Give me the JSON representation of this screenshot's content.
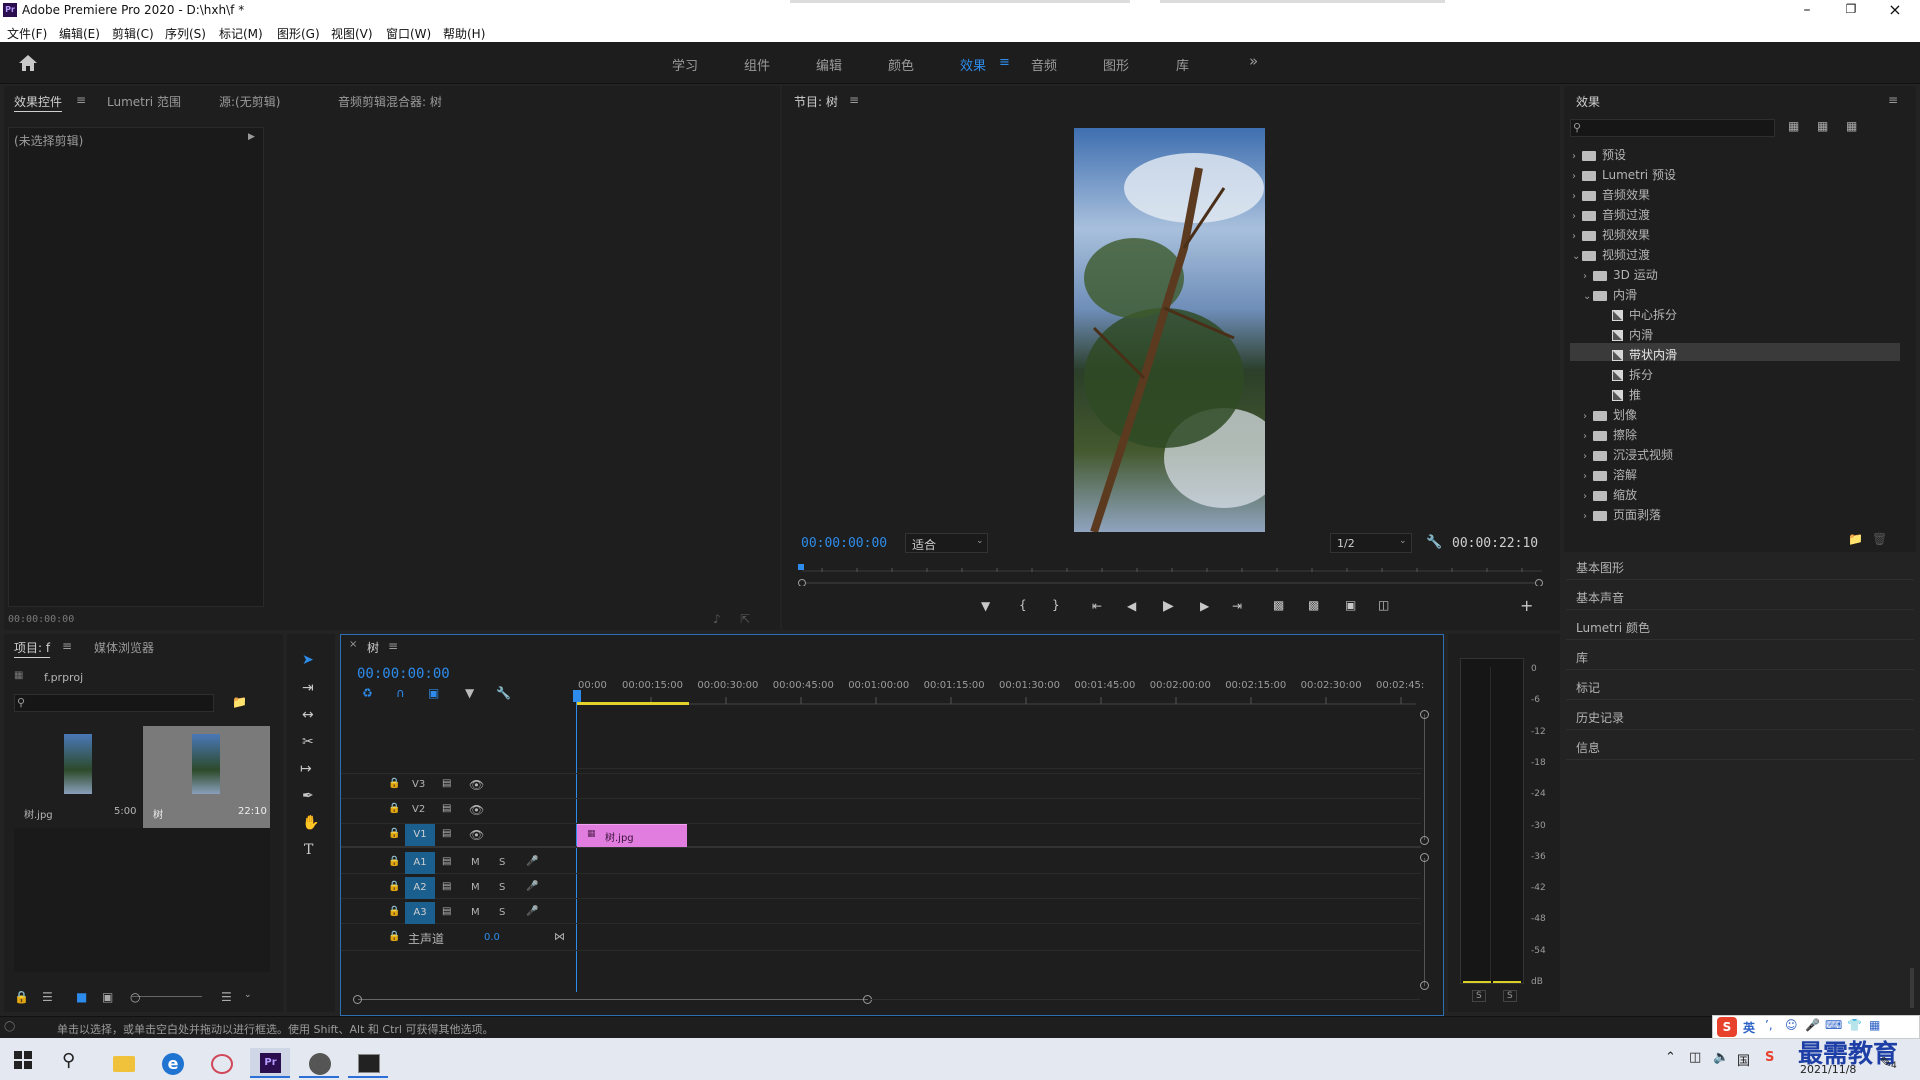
{
  "app": {
    "title": "Adobe Premiere Pro 2020 - D:\\hxh\\f *",
    "icon_text": "Pr"
  },
  "menu": [
    "文件(F)",
    "编辑(E)",
    "剪辑(C)",
    "序列(S)",
    "标记(M)",
    "图形(G)",
    "视图(V)",
    "窗口(W)",
    "帮助(H)"
  ],
  "workspaces": [
    "学习",
    "组件",
    "编辑",
    "颜色",
    "效果",
    "音频",
    "图形",
    "库"
  ],
  "workspace_active": "效果",
  "left_panel": {
    "tabs": [
      "效果控件",
      "Lumetri 范围",
      "源:(无剪辑)",
      "音频剪辑混合器: 树"
    ],
    "no_clip": "(未选择剪辑)",
    "timecode": "00:00:00:00"
  },
  "program": {
    "title": "节目: 树",
    "timecode": "00:00:00:00",
    "fit": "适合",
    "quality": "1/2",
    "duration": "00:00:22:10"
  },
  "effects_panel": {
    "title": "效果",
    "search_placeholder": "",
    "tree": [
      {
        "label": "预设",
        "level": 0,
        "type": "folder",
        "open": false
      },
      {
        "label": "Lumetri 预设",
        "level": 0,
        "type": "folder",
        "open": false
      },
      {
        "label": "音频效果",
        "level": 0,
        "type": "folder",
        "open": false
      },
      {
        "label": "音频过渡",
        "level": 0,
        "type": "folder",
        "open": false
      },
      {
        "label": "视频效果",
        "level": 0,
        "type": "folder",
        "open": false
      },
      {
        "label": "视频过渡",
        "level": 0,
        "type": "folder",
        "open": true
      },
      {
        "label": "3D 运动",
        "level": 1,
        "type": "folder",
        "open": false
      },
      {
        "label": "内滑",
        "level": 1,
        "type": "folder",
        "open": true
      },
      {
        "label": "中心拆分",
        "level": 2,
        "type": "effect"
      },
      {
        "label": "内滑",
        "level": 2,
        "type": "effect"
      },
      {
        "label": "带状内滑",
        "level": 2,
        "type": "effect",
        "selected": true
      },
      {
        "label": "拆分",
        "level": 2,
        "type": "effect"
      },
      {
        "label": "推",
        "level": 2,
        "type": "effect"
      },
      {
        "label": "划像",
        "level": 1,
        "type": "folder",
        "open": false
      },
      {
        "label": "擦除",
        "level": 1,
        "type": "folder",
        "open": false
      },
      {
        "label": "沉浸式视频",
        "level": 1,
        "type": "folder",
        "open": false
      },
      {
        "label": "溶解",
        "level": 1,
        "type": "folder",
        "open": false
      },
      {
        "label": "缩放",
        "level": 1,
        "type": "folder",
        "open": false
      },
      {
        "label": "页面剥落",
        "level": 1,
        "type": "folder",
        "open": false
      }
    ],
    "side_panels": [
      "基本图形",
      "基本声音",
      "Lumetri 颜色",
      "库",
      "标记",
      "历史记录",
      "信息"
    ]
  },
  "project": {
    "tabs": [
      "项目: f",
      "媒体浏览器"
    ],
    "file": "f.prproj",
    "items": [
      {
        "name": "树.jpg",
        "duration": "5:00"
      },
      {
        "name": "树",
        "duration": "22:10"
      }
    ]
  },
  "timeline": {
    "sequence": "树",
    "timecode": "00:00:00:00",
    "ruler": [
      "00:00",
      "00:00:15:00",
      "00:00:30:00",
      "00:00:45:00",
      "00:01:00:00",
      "00:01:15:00",
      "00:01:30:00",
      "00:01:45:00",
      "00:02:00:00",
      "00:02:15:00",
      "00:02:30:00",
      "00:02:45:"
    ],
    "video_tracks": [
      "V3",
      "V2",
      "V1"
    ],
    "audio_tracks": [
      "A1",
      "A2",
      "A3"
    ],
    "master_label": "主声道",
    "master_value": "0.0",
    "clip_label": "树.jpg",
    "clip_color": "#e27de0"
  },
  "meter": {
    "scale": [
      "0",
      "-6",
      "-12",
      "-18",
      "-24",
      "-30",
      "-36",
      "-42",
      "-48",
      "-54",
      "dB"
    ],
    "solo": [
      "S",
      "S"
    ]
  },
  "status": {
    "hint": "单击以选择，或单击空白处并拖动以进行框选。使用 Shift、Alt 和 Ctrl 可获得其他选项。"
  },
  "taskbar": {
    "date": "2021/11/8",
    "ime": "英",
    "watermark": "最需教育",
    "notification_count": "4"
  },
  "colors": {
    "accent": "#2d8ceb",
    "panel_bg": "#1e1e1e",
    "track_badge": "#1b5f8f",
    "clip": "#e27de0"
  }
}
